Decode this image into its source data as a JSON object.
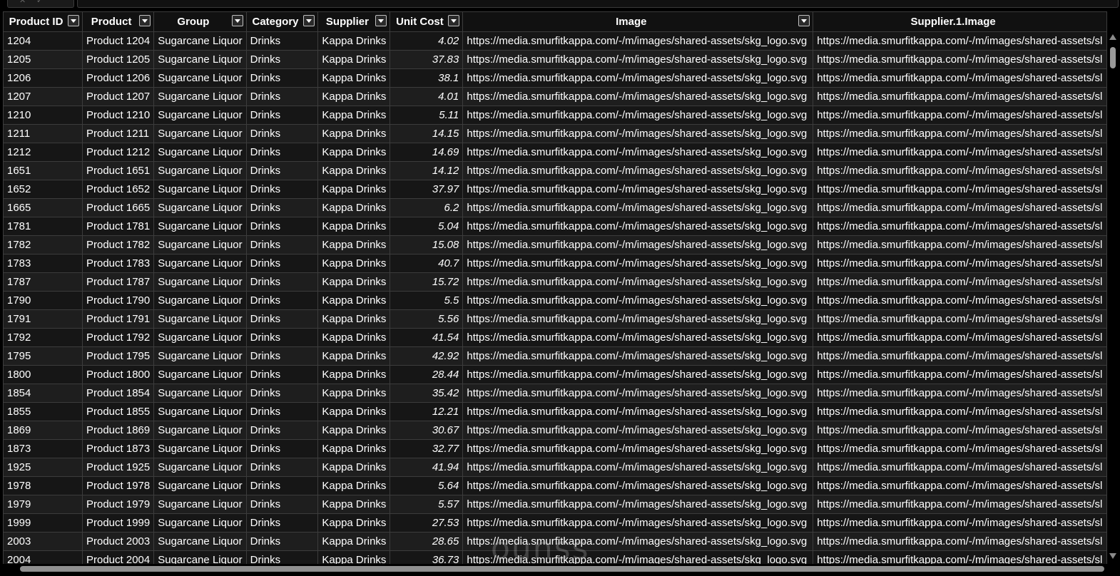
{
  "colors": {
    "background": "#000000",
    "row_odd": "#161616",
    "row_even": "#1e1e1e",
    "grid_line": "#3c3c3c",
    "text": "#ffffff"
  },
  "columns": [
    {
      "key": "product_id",
      "label": "Product ID",
      "icon": "dropdown-arrow-icon"
    },
    {
      "key": "product",
      "label": "Product",
      "icon": "dropdown-arrow-icon"
    },
    {
      "key": "group",
      "label": "Group",
      "icon": "dropdown-arrow-icon"
    },
    {
      "key": "category",
      "label": "Category",
      "icon": "dropdown-arrow-icon"
    },
    {
      "key": "supplier",
      "label": "Supplier",
      "icon": "dropdown-arrow-icon"
    },
    {
      "key": "unit_cost",
      "label": "Unit Cost",
      "icon": "dropdown-arrow-icon"
    },
    {
      "key": "image",
      "label": "Image",
      "icon": "dropdown-arrow-icon"
    },
    {
      "key": "supplier_image",
      "label": "Supplier.1.Image",
      "icon": ""
    }
  ],
  "rows": [
    {
      "product_id": "1204",
      "product": "Product 1204",
      "group": "Sugarcane Liquor",
      "category": "Drinks",
      "supplier": "Kappa Drinks",
      "unit_cost": "4.02",
      "image": "https://media.smurfitkappa.com/-/m/images/shared-assets/skg_logo.svg",
      "supplier_image": "https://media.smurfitkappa.com/-/m/images/shared-assets/sl"
    },
    {
      "product_id": "1205",
      "product": "Product 1205",
      "group": "Sugarcane Liquor",
      "category": "Drinks",
      "supplier": "Kappa Drinks",
      "unit_cost": "37.83",
      "image": "https://media.smurfitkappa.com/-/m/images/shared-assets/skg_logo.svg",
      "supplier_image": "https://media.smurfitkappa.com/-/m/images/shared-assets/sl"
    },
    {
      "product_id": "1206",
      "product": "Product 1206",
      "group": "Sugarcane Liquor",
      "category": "Drinks",
      "supplier": "Kappa Drinks",
      "unit_cost": "38.1",
      "image": "https://media.smurfitkappa.com/-/m/images/shared-assets/skg_logo.svg",
      "supplier_image": "https://media.smurfitkappa.com/-/m/images/shared-assets/sl"
    },
    {
      "product_id": "1207",
      "product": "Product 1207",
      "group": "Sugarcane Liquor",
      "category": "Drinks",
      "supplier": "Kappa Drinks",
      "unit_cost": "4.01",
      "image": "https://media.smurfitkappa.com/-/m/images/shared-assets/skg_logo.svg",
      "supplier_image": "https://media.smurfitkappa.com/-/m/images/shared-assets/sl"
    },
    {
      "product_id": "1210",
      "product": "Product 1210",
      "group": "Sugarcane Liquor",
      "category": "Drinks",
      "supplier": "Kappa Drinks",
      "unit_cost": "5.11",
      "image": "https://media.smurfitkappa.com/-/m/images/shared-assets/skg_logo.svg",
      "supplier_image": "https://media.smurfitkappa.com/-/m/images/shared-assets/sl"
    },
    {
      "product_id": "1211",
      "product": "Product 1211",
      "group": "Sugarcane Liquor",
      "category": "Drinks",
      "supplier": "Kappa Drinks",
      "unit_cost": "14.15",
      "image": "https://media.smurfitkappa.com/-/m/images/shared-assets/skg_logo.svg",
      "supplier_image": "https://media.smurfitkappa.com/-/m/images/shared-assets/sl"
    },
    {
      "product_id": "1212",
      "product": "Product 1212",
      "group": "Sugarcane Liquor",
      "category": "Drinks",
      "supplier": "Kappa Drinks",
      "unit_cost": "14.69",
      "image": "https://media.smurfitkappa.com/-/m/images/shared-assets/skg_logo.svg",
      "supplier_image": "https://media.smurfitkappa.com/-/m/images/shared-assets/sl"
    },
    {
      "product_id": "1651",
      "product": "Product 1651",
      "group": "Sugarcane Liquor",
      "category": "Drinks",
      "supplier": "Kappa Drinks",
      "unit_cost": "14.12",
      "image": "https://media.smurfitkappa.com/-/m/images/shared-assets/skg_logo.svg",
      "supplier_image": "https://media.smurfitkappa.com/-/m/images/shared-assets/sl"
    },
    {
      "product_id": "1652",
      "product": "Product 1652",
      "group": "Sugarcane Liquor",
      "category": "Drinks",
      "supplier": "Kappa Drinks",
      "unit_cost": "37.97",
      "image": "https://media.smurfitkappa.com/-/m/images/shared-assets/skg_logo.svg",
      "supplier_image": "https://media.smurfitkappa.com/-/m/images/shared-assets/sl"
    },
    {
      "product_id": "1665",
      "product": "Product 1665",
      "group": "Sugarcane Liquor",
      "category": "Drinks",
      "supplier": "Kappa Drinks",
      "unit_cost": "6.2",
      "image": "https://media.smurfitkappa.com/-/m/images/shared-assets/skg_logo.svg",
      "supplier_image": "https://media.smurfitkappa.com/-/m/images/shared-assets/sl"
    },
    {
      "product_id": "1781",
      "product": "Product 1781",
      "group": "Sugarcane Liquor",
      "category": "Drinks",
      "supplier": "Kappa Drinks",
      "unit_cost": "5.04",
      "image": "https://media.smurfitkappa.com/-/m/images/shared-assets/skg_logo.svg",
      "supplier_image": "https://media.smurfitkappa.com/-/m/images/shared-assets/sl"
    },
    {
      "product_id": "1782",
      "product": "Product 1782",
      "group": "Sugarcane Liquor",
      "category": "Drinks",
      "supplier": "Kappa Drinks",
      "unit_cost": "15.08",
      "image": "https://media.smurfitkappa.com/-/m/images/shared-assets/skg_logo.svg",
      "supplier_image": "https://media.smurfitkappa.com/-/m/images/shared-assets/sl"
    },
    {
      "product_id": "1783",
      "product": "Product 1783",
      "group": "Sugarcane Liquor",
      "category": "Drinks",
      "supplier": "Kappa Drinks",
      "unit_cost": "40.7",
      "image": "https://media.smurfitkappa.com/-/m/images/shared-assets/skg_logo.svg",
      "supplier_image": "https://media.smurfitkappa.com/-/m/images/shared-assets/sl"
    },
    {
      "product_id": "1787",
      "product": "Product 1787",
      "group": "Sugarcane Liquor",
      "category": "Drinks",
      "supplier": "Kappa Drinks",
      "unit_cost": "15.72",
      "image": "https://media.smurfitkappa.com/-/m/images/shared-assets/skg_logo.svg",
      "supplier_image": "https://media.smurfitkappa.com/-/m/images/shared-assets/sl"
    },
    {
      "product_id": "1790",
      "product": "Product 1790",
      "group": "Sugarcane Liquor",
      "category": "Drinks",
      "supplier": "Kappa Drinks",
      "unit_cost": "5.5",
      "image": "https://media.smurfitkappa.com/-/m/images/shared-assets/skg_logo.svg",
      "supplier_image": "https://media.smurfitkappa.com/-/m/images/shared-assets/sl"
    },
    {
      "product_id": "1791",
      "product": "Product 1791",
      "group": "Sugarcane Liquor",
      "category": "Drinks",
      "supplier": "Kappa Drinks",
      "unit_cost": "5.56",
      "image": "https://media.smurfitkappa.com/-/m/images/shared-assets/skg_logo.svg",
      "supplier_image": "https://media.smurfitkappa.com/-/m/images/shared-assets/sl"
    },
    {
      "product_id": "1792",
      "product": "Product 1792",
      "group": "Sugarcane Liquor",
      "category": "Drinks",
      "supplier": "Kappa Drinks",
      "unit_cost": "41.54",
      "image": "https://media.smurfitkappa.com/-/m/images/shared-assets/skg_logo.svg",
      "supplier_image": "https://media.smurfitkappa.com/-/m/images/shared-assets/sl"
    },
    {
      "product_id": "1795",
      "product": "Product 1795",
      "group": "Sugarcane Liquor",
      "category": "Drinks",
      "supplier": "Kappa Drinks",
      "unit_cost": "42.92",
      "image": "https://media.smurfitkappa.com/-/m/images/shared-assets/skg_logo.svg",
      "supplier_image": "https://media.smurfitkappa.com/-/m/images/shared-assets/sl"
    },
    {
      "product_id": "1800",
      "product": "Product 1800",
      "group": "Sugarcane Liquor",
      "category": "Drinks",
      "supplier": "Kappa Drinks",
      "unit_cost": "28.44",
      "image": "https://media.smurfitkappa.com/-/m/images/shared-assets/skg_logo.svg",
      "supplier_image": "https://media.smurfitkappa.com/-/m/images/shared-assets/sl"
    },
    {
      "product_id": "1854",
      "product": "Product 1854",
      "group": "Sugarcane Liquor",
      "category": "Drinks",
      "supplier": "Kappa Drinks",
      "unit_cost": "35.42",
      "image": "https://media.smurfitkappa.com/-/m/images/shared-assets/skg_logo.svg",
      "supplier_image": "https://media.smurfitkappa.com/-/m/images/shared-assets/sl"
    },
    {
      "product_id": "1855",
      "product": "Product 1855",
      "group": "Sugarcane Liquor",
      "category": "Drinks",
      "supplier": "Kappa Drinks",
      "unit_cost": "12.21",
      "image": "https://media.smurfitkappa.com/-/m/images/shared-assets/skg_logo.svg",
      "supplier_image": "https://media.smurfitkappa.com/-/m/images/shared-assets/sl"
    },
    {
      "product_id": "1869",
      "product": "Product 1869",
      "group": "Sugarcane Liquor",
      "category": "Drinks",
      "supplier": "Kappa Drinks",
      "unit_cost": "30.67",
      "image": "https://media.smurfitkappa.com/-/m/images/shared-assets/skg_logo.svg",
      "supplier_image": "https://media.smurfitkappa.com/-/m/images/shared-assets/sl"
    },
    {
      "product_id": "1873",
      "product": "Product 1873",
      "group": "Sugarcane Liquor",
      "category": "Drinks",
      "supplier": "Kappa Drinks",
      "unit_cost": "32.77",
      "image": "https://media.smurfitkappa.com/-/m/images/shared-assets/skg_logo.svg",
      "supplier_image": "https://media.smurfitkappa.com/-/m/images/shared-assets/sl"
    },
    {
      "product_id": "1925",
      "product": "Product 1925",
      "group": "Sugarcane Liquor",
      "category": "Drinks",
      "supplier": "Kappa Drinks",
      "unit_cost": "41.94",
      "image": "https://media.smurfitkappa.com/-/m/images/shared-assets/skg_logo.svg",
      "supplier_image": "https://media.smurfitkappa.com/-/m/images/shared-assets/sl"
    },
    {
      "product_id": "1978",
      "product": "Product 1978",
      "group": "Sugarcane Liquor",
      "category": "Drinks",
      "supplier": "Kappa Drinks",
      "unit_cost": "5.64",
      "image": "https://media.smurfitkappa.com/-/m/images/shared-assets/skg_logo.svg",
      "supplier_image": "https://media.smurfitkappa.com/-/m/images/shared-assets/sl"
    },
    {
      "product_id": "1979",
      "product": "Product 1979",
      "group": "Sugarcane Liquor",
      "category": "Drinks",
      "supplier": "Kappa Drinks",
      "unit_cost": "5.57",
      "image": "https://media.smurfitkappa.com/-/m/images/shared-assets/skg_logo.svg",
      "supplier_image": "https://media.smurfitkappa.com/-/m/images/shared-assets/sl"
    },
    {
      "product_id": "1999",
      "product": "Product 1999",
      "group": "Sugarcane Liquor",
      "category": "Drinks",
      "supplier": "Kappa Drinks",
      "unit_cost": "27.53",
      "image": "https://media.smurfitkappa.com/-/m/images/shared-assets/skg_logo.svg",
      "supplier_image": "https://media.smurfitkappa.com/-/m/images/shared-assets/sl"
    },
    {
      "product_id": "2003",
      "product": "Product 2003",
      "group": "Sugarcane Liquor",
      "category": "Drinks",
      "supplier": "Kappa Drinks",
      "unit_cost": "28.65",
      "image": "https://media.smurfitkappa.com/-/m/images/shared-assets/skg_logo.svg",
      "supplier_image": "https://media.smurfitkappa.com/-/m/images/shared-assets/sl"
    },
    {
      "product_id": "2004",
      "product": "Product 2004",
      "group": "Sugarcane Liquor",
      "category": "Drinks",
      "supplier": "Kappa Drinks",
      "unit_cost": "36.73",
      "image": "https://media.smurfitkappa.com/-/m/images/shared-assets/skg_logo.svg",
      "supplier_image": "https://media.smurfitkappa.com/-/m/images/shared-assets/sl"
    }
  ],
  "watermark": "ounss"
}
